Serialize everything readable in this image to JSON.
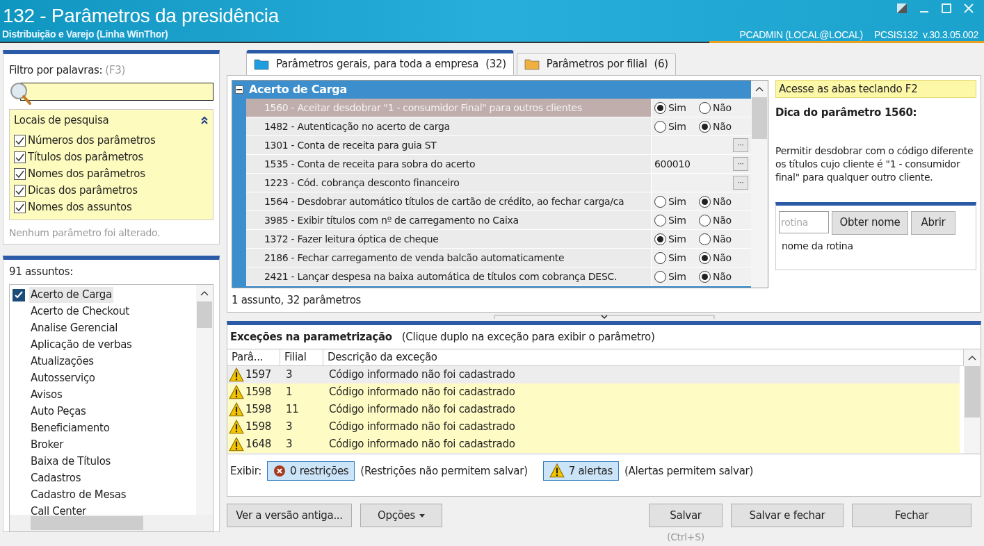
{
  "window": {
    "title": "132 - Parâmetros da presidência",
    "subtitle": "Distribuição e Varejo (Linha WinThor)",
    "user": "PCADMIN (LOCAL@LOCAL)",
    "version": "PCSIS132  v.30.3.05.002"
  },
  "filter": {
    "label": "Filtro por palavras:",
    "shortcut": "(F3)",
    "group_title": "Locais de pesquisa",
    "options": [
      {
        "label": "Números dos parâmetros",
        "checked": true
      },
      {
        "label": "Títulos dos parâmetros",
        "checked": true
      },
      {
        "label": "Nomes dos parâmetros",
        "checked": true
      },
      {
        "label": "Dicas dos parâmetros",
        "checked": true
      },
      {
        "label": "Nomes dos assuntos",
        "checked": true
      }
    ],
    "status": "Nenhum parâmetro foi alterado."
  },
  "subjects": {
    "count": "91 assuntos:",
    "items": [
      {
        "label": "Acerto de Carga",
        "checked": true,
        "selected": true
      },
      {
        "label": "Acerto de Checkout",
        "checked": false,
        "selected": false
      },
      {
        "label": "Analise Gerencial",
        "checked": false,
        "selected": false
      },
      {
        "label": "Aplicação de verbas",
        "checked": false,
        "selected": false
      },
      {
        "label": "Atualizações",
        "checked": false,
        "selected": false
      },
      {
        "label": "Autosserviço",
        "checked": false,
        "selected": false
      },
      {
        "label": "Avisos",
        "checked": false,
        "selected": false
      },
      {
        "label": "Auto Peças",
        "checked": false,
        "selected": false
      },
      {
        "label": "Beneficiamento",
        "checked": false,
        "selected": false
      },
      {
        "label": "Broker",
        "checked": false,
        "selected": false
      },
      {
        "label": "Baixa de Títulos",
        "checked": false,
        "selected": false
      },
      {
        "label": "Cadastros",
        "checked": false,
        "selected": false
      },
      {
        "label": "Cadastro de Mesas",
        "checked": false,
        "selected": false
      },
      {
        "label": "Call Center",
        "checked": false,
        "selected": false
      }
    ]
  },
  "tabs": [
    {
      "label": "Parâmetros gerais, para toda a empresa",
      "count": "(32)",
      "selected": true
    },
    {
      "label": "Parâmetros por filial",
      "count": "(6)",
      "selected": false
    }
  ],
  "group": {
    "title": "Acerto de Carga",
    "expanded": true,
    "rows": [
      {
        "title": "1560 - Aceitar desdobrar \"1 - consumidor Final\" para outros clientes",
        "kind": "radio",
        "selected": true,
        "options": [
          {
            "label": "Sim",
            "selected": true
          },
          {
            "label": "Não",
            "selected": false
          }
        ]
      },
      {
        "title": "1482 - Autenticação no acerto de carga",
        "kind": "radio",
        "selected": false,
        "options": [
          {
            "label": "Sim",
            "selected": false
          },
          {
            "label": "Não",
            "selected": true
          }
        ]
      },
      {
        "title": "1301 - Conta de receita para guia ST",
        "kind": "lookup",
        "selected": false,
        "button": "···"
      },
      {
        "title": "1535 - Conta de receita para sobra do acerto",
        "kind": "lookup",
        "selected": false,
        "value": "600010",
        "button": "···"
      },
      {
        "title": "1223 - Cód. cobrança desconto financeiro",
        "kind": "lookup",
        "selected": false,
        "button": "···"
      },
      {
        "title": "1564 - Desdobrar automático títulos de cartão de crédito, ao fechar carga/ca",
        "kind": "radio",
        "selected": false,
        "options": [
          {
            "label": "Sim",
            "selected": false
          },
          {
            "label": "Não",
            "selected": true
          }
        ]
      },
      {
        "title": "3985 - Exibir títulos com nº de carregamento no Caixa",
        "kind": "radio",
        "selected": false,
        "options": [
          {
            "label": "Sim",
            "selected": false
          },
          {
            "label": "Não",
            "selected": false
          }
        ]
      },
      {
        "title": "1372 - Fazer leitura óptica de cheque",
        "kind": "radio",
        "selected": false,
        "options": [
          {
            "label": "Sim",
            "selected": true
          },
          {
            "label": "Não",
            "selected": false
          }
        ]
      },
      {
        "title": "2186 - Fechar carregamento de venda balcão automaticamente",
        "kind": "radio",
        "selected": false,
        "options": [
          {
            "label": "Sim",
            "selected": false
          },
          {
            "label": "Não",
            "selected": true
          }
        ]
      },
      {
        "title": "2421 - Lançar despesa na baixa automática de títulos com cobrança DESC.",
        "kind": "radio",
        "selected": false,
        "options": [
          {
            "label": "Sim",
            "selected": false
          },
          {
            "label": "Não",
            "selected": true
          }
        ]
      }
    ],
    "summary": "1 assunto, 32 parâmetros"
  },
  "hint": {
    "banner": "Acesse as abas teclando F2",
    "title": "Dica do parâmetro 1560:",
    "text": "Permitir desdobrar com o código diferente os títulos cujo cliente é \"1 - consumidor final\" para qualquer outro cliente.",
    "routine_placeholder": "rotina",
    "get_name": "Obter nome",
    "open": "Abrir",
    "routine_name": "nome da rotina"
  },
  "exceptions": {
    "title": "Exceções na parametrização",
    "note": "(Clique duplo na exceção para exibir o parâmetro)",
    "columns": [
      "Parâ...",
      "Filial",
      "Descrição da exceção"
    ],
    "rows": [
      {
        "param": "1597",
        "branch": "3",
        "description": "Código informado não foi cadastrado",
        "selected": true
      },
      {
        "param": "1598",
        "branch": "1",
        "description": "Código informado não foi cadastrado",
        "selected": false
      },
      {
        "param": "1598",
        "branch": "11",
        "description": "Código informado não foi cadastrado",
        "selected": false
      },
      {
        "param": "1598",
        "branch": "3",
        "description": "Código informado não foi cadastrado",
        "selected": false
      },
      {
        "param": "1648",
        "branch": "3",
        "description": "Código informado não foi cadastrado",
        "selected": false
      }
    ],
    "show_label": "Exibir:",
    "restrictions": "0 restrições",
    "restrictions_note": "(Restrições não permitem salvar)",
    "alerts": "7 alertas",
    "alerts_note": "(Alertas permitem salvar)"
  },
  "buttons": {
    "old_version": "Ver a versão antiga...",
    "options": "Opções",
    "save": "Salvar",
    "save_shortcut": "(Ctrl+S)",
    "save_close": "Salvar e fechar",
    "close": "Fechar"
  }
}
